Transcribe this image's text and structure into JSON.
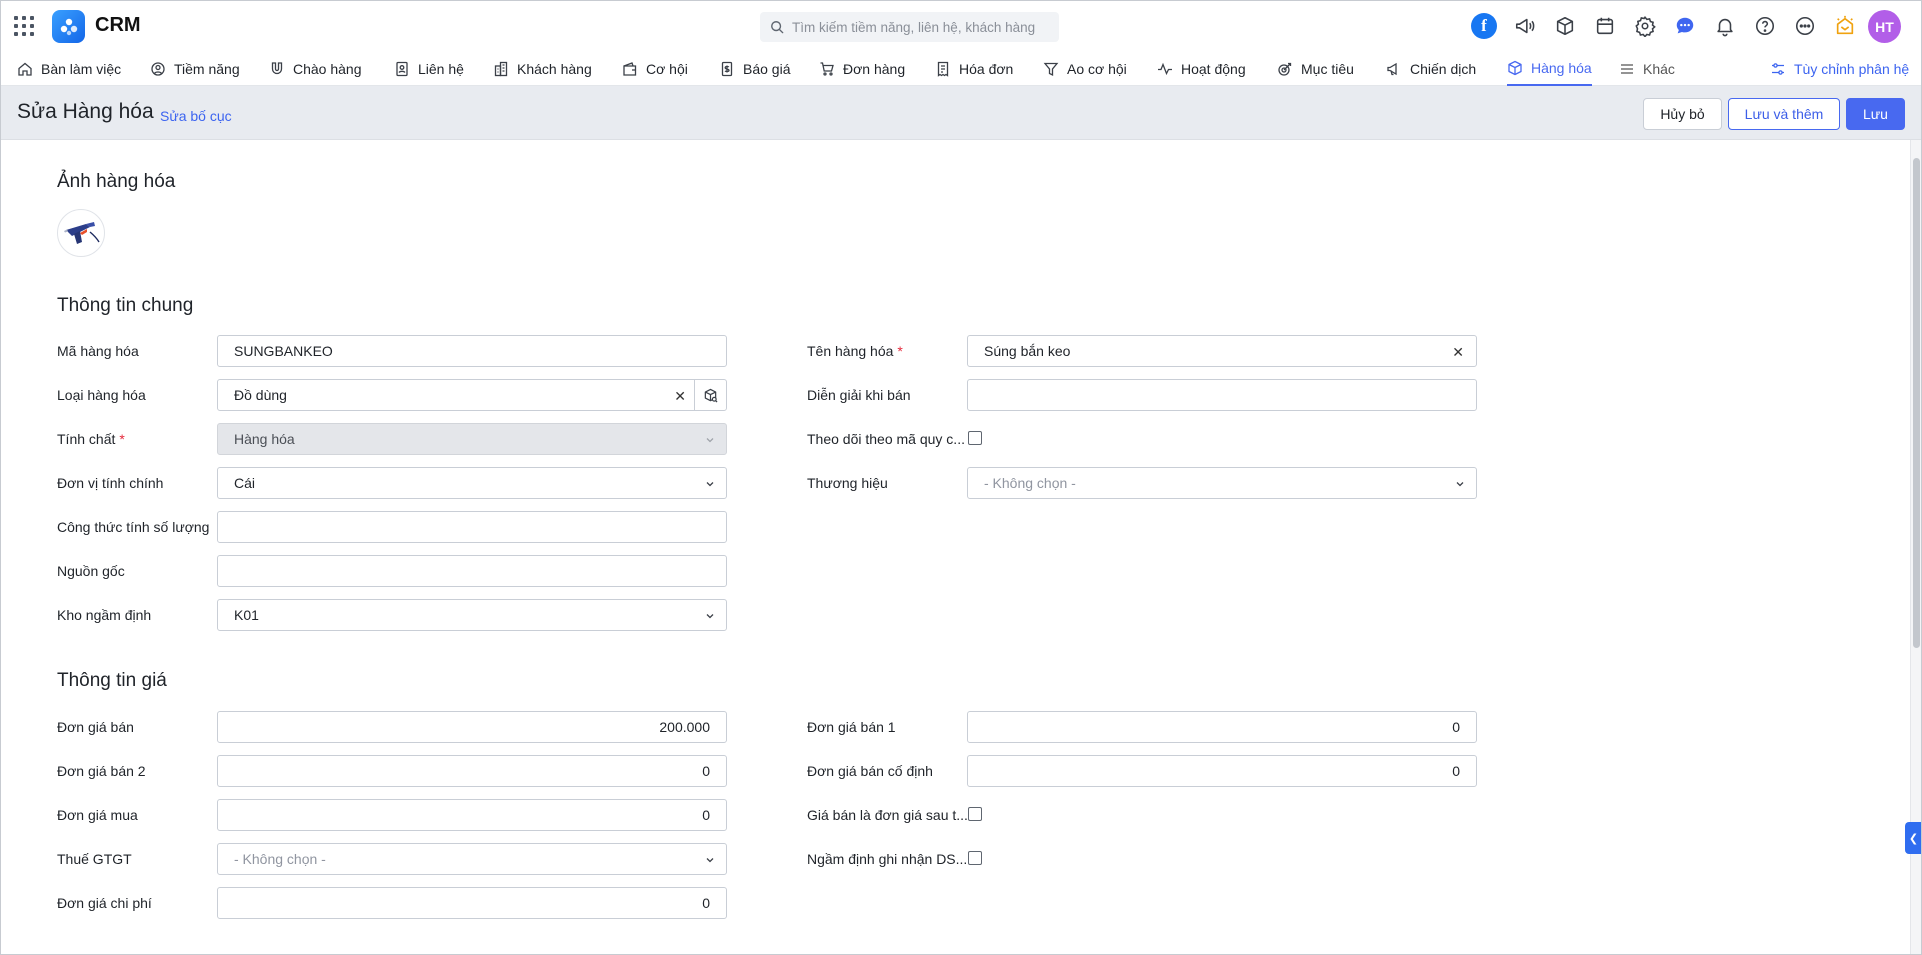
{
  "app": {
    "name": "CRM"
  },
  "search": {
    "placeholder": "Tìm kiếm tiềm năng, liên hệ, khách hàng"
  },
  "user": {
    "initials": "HT"
  },
  "colors": {
    "accent": "#4869f0",
    "avatar": "#b25ee8",
    "required": "#e5283a"
  },
  "nav": {
    "items": [
      {
        "label": "Bàn làm việc",
        "icon": "home-icon"
      },
      {
        "label": "Tiềm năng",
        "icon": "target-user-icon"
      },
      {
        "label": "Chào hàng",
        "icon": "magnet-icon"
      },
      {
        "label": "Liên hệ",
        "icon": "contact-card-icon"
      },
      {
        "label": "Khách hàng",
        "icon": "building-icon"
      },
      {
        "label": "Cơ hội",
        "icon": "wallet-icon"
      },
      {
        "label": "Báo giá",
        "icon": "quote-document-icon"
      },
      {
        "label": "Đơn hàng",
        "icon": "cart-icon"
      },
      {
        "label": "Hóa đơn",
        "icon": "invoice-icon"
      },
      {
        "label": "Ao cơ hội",
        "icon": "funnel-icon"
      },
      {
        "label": "Hoạt động",
        "icon": "activity-pulse-icon"
      },
      {
        "label": "Mục tiêu",
        "icon": "goal-icon"
      },
      {
        "label": "Chiến dịch",
        "icon": "megaphone-icon"
      },
      {
        "label": "Hàng hóa",
        "icon": "box-icon"
      },
      {
        "label": "Khác",
        "icon": "menu-lines-icon"
      }
    ],
    "customize": "Tùy chỉnh phân hệ"
  },
  "header": {
    "title": "Sửa Hàng hóa",
    "edit_layout": "Sửa bố cục",
    "cancel": "Hủy bỏ",
    "save_and_add": "Lưu và thêm",
    "save": "Lưu"
  },
  "sections": {
    "image": "Ảnh hàng hóa",
    "general": "Thông tin chung",
    "price": "Thông tin giá"
  },
  "general": {
    "product_code": {
      "label": "Mã hàng hóa",
      "value": "SUNGBANKEO"
    },
    "product_name": {
      "label": "Tên hàng hóa",
      "value": "Súng bắn keo"
    },
    "product_type": {
      "label": "Loại hàng hóa",
      "value": "Đồ dùng"
    },
    "sale_description": {
      "label": "Diễn giải khi bán",
      "value": ""
    },
    "nature": {
      "label": "Tính chất",
      "value": "Hàng hóa"
    },
    "track_by_spec": {
      "label": "Theo dõi theo mã quy c...",
      "checked": false
    },
    "main_unit": {
      "label": "Đơn vị tính chính",
      "value": "Cái"
    },
    "brand": {
      "label": "Thương hiệu",
      "placeholder": "- Không chọn -"
    },
    "quantity_formula": {
      "label": "Công thức tính số lượng",
      "value": ""
    },
    "origin": {
      "label": "Nguồn gốc",
      "value": ""
    },
    "default_warehouse": {
      "label": "Kho ngầm định",
      "value": "K01"
    }
  },
  "price": {
    "sale_price": {
      "label": "Đơn giá bán",
      "value": "200.000"
    },
    "sale_price_1": {
      "label": "Đơn giá bán 1",
      "value": "0"
    },
    "sale_price_2": {
      "label": "Đơn giá bán 2",
      "value": "0"
    },
    "fixed_sale_price": {
      "label": "Đơn giá bán cố định",
      "value": "0"
    },
    "purchase_price": {
      "label": "Đơn giá mua",
      "value": "0"
    },
    "price_after_tax": {
      "label": "Giá bán là đơn giá sau t...",
      "checked": false
    },
    "vat": {
      "label": "Thuế GTGT",
      "placeholder": "- Không chọn -"
    },
    "default_record_revenue": {
      "label": "Ngầm định ghi nhận DS...",
      "checked": false
    },
    "cost_price": {
      "label": "Đơn giá chi phí",
      "value": "0"
    }
  }
}
